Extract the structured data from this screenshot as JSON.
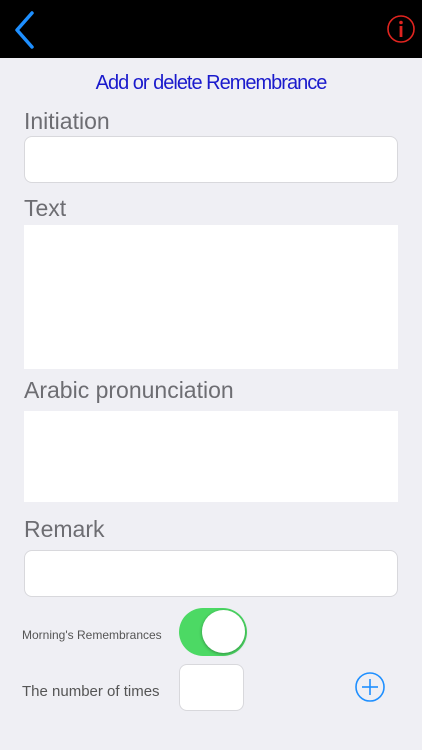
{
  "header": {
    "back_icon": "chevron-left-icon",
    "info_icon": "info-icon",
    "accent_color": "#1e8fff",
    "info_color": "#e0241f"
  },
  "page": {
    "title": "Add or delete Remembrance"
  },
  "form": {
    "initiation_label": "Initiation",
    "initiation_value": "",
    "text_label": "Text",
    "text_value": "",
    "arabic_label": "Arabic pronunciation",
    "arabic_value": "",
    "remark_label": "Remark",
    "remark_value": "",
    "morning_label": "Morning's Remembrances",
    "morning_on": true,
    "times_label": "The number of times",
    "times_value": "",
    "add_icon": "plus-circle-icon"
  }
}
